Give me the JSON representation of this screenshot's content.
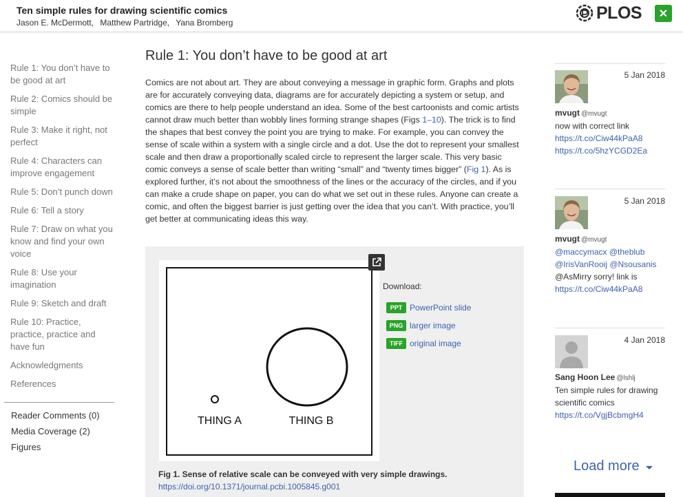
{
  "header": {
    "title": "Ten simple rules for drawing scientific comics",
    "authors": [
      "Jason E. McDermott,",
      "Matthew Partridge,",
      "Yana Bromberg"
    ],
    "logo_text": "PLOS",
    "close_label": "✕"
  },
  "nav": {
    "items": [
      "Rule 1: You don’t have to be good at art",
      "Rule 2: Comics should be simple",
      "Rule 3: Make it right, not perfect",
      "Rule 4: Characters can improve engagement",
      "Rule 5: Don’t punch down",
      "Rule 6: Tell a story",
      "Rule 7: Draw on what you know and find your own voice",
      "Rule 8: Use your imagination",
      "Rule 9: Sketch and draft",
      "Rule 10: Practice, practice, practice and have fun",
      "Acknowledgments",
      "References"
    ],
    "secondary": [
      "Reader Comments (0)",
      "Media Coverage (2)",
      "Figures"
    ]
  },
  "main": {
    "section_title": "Rule 1: You don’t have to be good at art",
    "para_a": "Comics are not about art. They are about conveying a message in graphic form. Graphs and plots are for accurately conveying data, diagrams are for accurately depicting a system or setup, and comics are there to help people understand an idea. Some of the best cartoonists and comic artists cannot draw much better than wobbly lines forming strange shapes (Figs ",
    "link_figs": "1–10",
    "para_b": "). The trick is to find the shapes that best convey the point you are trying to make. For example, you can convey the sense of scale within a system with a single circle and a dot. Use the dot to represent your smallest scale and then draw a proportionally scaled circle to represent the larger scale. This very basic comic conveys a sense of scale better than writing “small” and “twenty times bigger” (",
    "link_fig1": "Fig 1",
    "para_c": "). As is explored further, it’s not about the smoothness of the lines or the accuracy of the circles, and if you can make a crude shape on paper, you can do what we set out in these rules. Anyone can create a comic, and often the biggest barrier is just getting over the idea that you can’t. With practice, you’ll get better at communicating ideas this way."
  },
  "figure": {
    "label_a": "THING A",
    "label_b": "THING B",
    "download_label": "Download:",
    "downloads": [
      {
        "badge": "PPT",
        "label": "PowerPoint slide"
      },
      {
        "badge": "PNG",
        "label": "larger image"
      },
      {
        "badge": "TIFF",
        "label": "original image"
      }
    ],
    "caption": "Fig 1. Sense of relative scale can be conveyed with very simple drawings.",
    "doi": "https://doi.org/10.1371/journal.pcbi.1005845.g001"
  },
  "feed": {
    "tweets": [
      {
        "date": "5 Jan 2018",
        "name": "mvugt",
        "handle": "@mvugt",
        "lines": [
          "now with correct link",
          "https://t.co/Ciw44kPaA8",
          "https://t.co/5hzYCGD2Ea"
        ]
      },
      {
        "date": "5 Jan 2018",
        "name": "mvugt",
        "handle": "@mvugt",
        "lines": [
          "@maccymacx @theblub",
          "@IrisVanRooij @Nsousanis",
          "@AsMirry sorry! link is",
          "https://t.co/Ciw44kPaA8"
        ]
      },
      {
        "date": "4 Jan 2018",
        "name": "Sang Hoon Lee",
        "handle": "@lshlj",
        "lines": [
          "Ten simple rules for drawing",
          "scientific comics",
          "https://t.co/VgjBcbmgH4"
        ]
      }
    ],
    "load_more": "Load more"
  },
  "colors": {
    "accent": "#29a329",
    "link": "#3c63af"
  }
}
